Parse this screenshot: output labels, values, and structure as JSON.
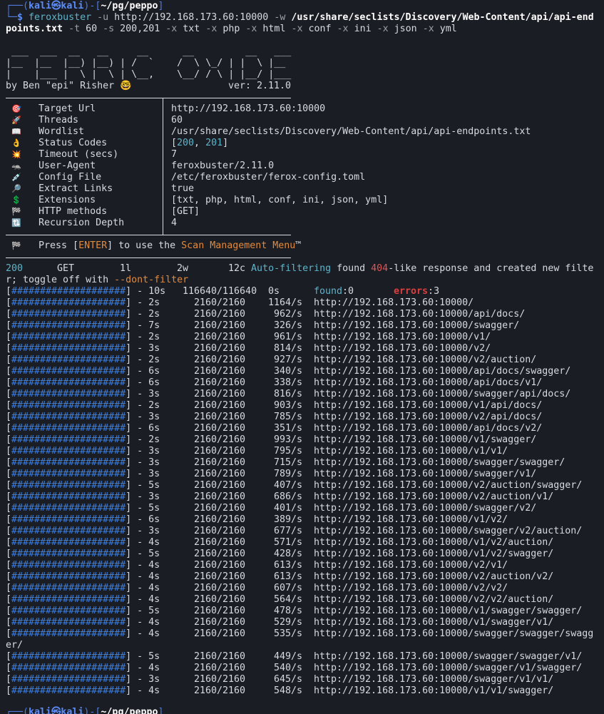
{
  "prompt": {
    "user": "kali",
    "at": "㉿",
    "host": "kali",
    "path": "~/pg/peppo",
    "cmd": "feroxbuster",
    "args": [
      {
        "flag": "-u",
        "val": "http://192.168.173.60:10000"
      },
      {
        "flag": "-w",
        "val": "/usr/share/seclists/Discovery/Web-Content/api/api-end"
      }
    ],
    "wrap_path": "points.txt",
    "wrap_args": [
      {
        "flag": "-t",
        "val": "60"
      },
      {
        "flag": "-s",
        "val": "200,201"
      },
      {
        "flag": "-x",
        "val": "txt"
      },
      {
        "flag": "-x",
        "val": "php"
      },
      {
        "flag": "-x",
        "val": "html"
      },
      {
        "flag": "-x",
        "val": "conf"
      },
      {
        "flag": "-x",
        "val": "ini"
      },
      {
        "flag": "-x",
        "val": "json"
      },
      {
        "flag": "-x",
        "val": "yml"
      }
    ]
  },
  "banner": {
    "art": [
      " ___  ___  __   __     __      __         __   ___",
      "|__  |__  |__) |__) | /  `    /  \\ \\_/ | |  \\ |__",
      "|    |___ |  \\ |  \\ | \\__,    \\__/ / \\ | |__/ |___"
    ],
    "author": "by Ben \"epi\" Risher 🤓",
    "version": "ver: 2.11.0"
  },
  "config": [
    {
      "icon": "🎯",
      "icon_name": "target-icon",
      "key": "Target Url",
      "value": "http://192.168.173.60:10000"
    },
    {
      "icon": "🚀",
      "icon_name": "rocket-icon",
      "key": "Threads",
      "value": "60"
    },
    {
      "icon": "📖",
      "icon_name": "book-icon",
      "key": "Wordlist",
      "value": "/usr/share/seclists/Discovery/Web-Content/api/api-endpoints.txt"
    },
    {
      "icon": "👌",
      "icon_name": "ok-hand-icon",
      "key": "Status Codes",
      "value": "",
      "codes": [
        "200",
        "201"
      ]
    },
    {
      "icon": "💥",
      "icon_name": "collision-icon",
      "key": "Timeout (secs)",
      "value": "7"
    },
    {
      "icon": "🦡",
      "icon_name": "badger-icon",
      "key": "User-Agent",
      "value": "feroxbuster/2.11.0"
    },
    {
      "icon": "💉",
      "icon_name": "syringe-icon",
      "key": "Config File",
      "value": "/etc/feroxbuster/ferox-config.toml"
    },
    {
      "icon": "🔎",
      "icon_name": "magnifier-icon",
      "key": "Extract Links",
      "value": "true"
    },
    {
      "icon": "💲",
      "icon_name": "dollar-icon",
      "key": "Extensions",
      "value": "[txt, php, html, conf, ini, json, yml]"
    },
    {
      "icon": "🏁",
      "icon_name": "flag-icon",
      "key": "HTTP methods",
      "value": "[GET]"
    },
    {
      "icon": "🔃",
      "icon_name": "recursion-icon",
      "key": "Recursion Depth",
      "value": "4"
    }
  ],
  "menu_hint": {
    "icon": "🏁",
    "pre": "Press [",
    "key": "ENTER",
    "mid": "] to use the ",
    "menu": "Scan Management Menu",
    "post": "™"
  },
  "autofilter": {
    "status": "200",
    "method": "GET",
    "lines": "1l",
    "words": "2w",
    "chars": "12c",
    "label": "Auto-filtering",
    "pre": " found ",
    "code": "404",
    "post": "-like response and created new filte",
    "wrap": "r; toggle off with ",
    "flag": "--dont-filter"
  },
  "overall": {
    "bar": "####################",
    "time": "10s",
    "count": "116640/116640",
    "rate": "0s",
    "found_label": "found",
    "found": "0",
    "errors_label": "errors",
    "errors": "3"
  },
  "progress": [
    {
      "time": "2s",
      "count": "2160/2160",
      "rate": "1164/s",
      "url": "http://192.168.173.60:10000/"
    },
    {
      "time": "2s",
      "count": "2160/2160",
      "rate": "962/s",
      "url": "http://192.168.173.60:10000/api/docs/"
    },
    {
      "time": "7s",
      "count": "2160/2160",
      "rate": "326/s",
      "url": "http://192.168.173.60:10000/swagger/"
    },
    {
      "time": "2s",
      "count": "2160/2160",
      "rate": "961/s",
      "url": "http://192.168.173.60:10000/v1/"
    },
    {
      "time": "3s",
      "count": "2160/2160",
      "rate": "814/s",
      "url": "http://192.168.173.60:10000/v2/"
    },
    {
      "time": "2s",
      "count": "2160/2160",
      "rate": "927/s",
      "url": "http://192.168.173.60:10000/v2/auction/"
    },
    {
      "time": "6s",
      "count": "2160/2160",
      "rate": "340/s",
      "url": "http://192.168.173.60:10000/api/docs/swagger/"
    },
    {
      "time": "6s",
      "count": "2160/2160",
      "rate": "338/s",
      "url": "http://192.168.173.60:10000/api/docs/v1/"
    },
    {
      "time": "3s",
      "count": "2160/2160",
      "rate": "816/s",
      "url": "http://192.168.173.60:10000/swagger/api/docs/"
    },
    {
      "time": "2s",
      "count": "2160/2160",
      "rate": "903/s",
      "url": "http://192.168.173.60:10000/v1/api/docs/"
    },
    {
      "time": "3s",
      "count": "2160/2160",
      "rate": "785/s",
      "url": "http://192.168.173.60:10000/v2/api/docs/"
    },
    {
      "time": "6s",
      "count": "2160/2160",
      "rate": "351/s",
      "url": "http://192.168.173.60:10000/api/docs/v2/"
    },
    {
      "time": "2s",
      "count": "2160/2160",
      "rate": "993/s",
      "url": "http://192.168.173.60:10000/v1/swagger/"
    },
    {
      "time": "3s",
      "count": "2160/2160",
      "rate": "795/s",
      "url": "http://192.168.173.60:10000/v1/v1/"
    },
    {
      "time": "3s",
      "count": "2160/2160",
      "rate": "715/s",
      "url": "http://192.168.173.60:10000/swagger/swagger/"
    },
    {
      "time": "3s",
      "count": "2160/2160",
      "rate": "789/s",
      "url": "http://192.168.173.60:10000/swagger/v1/"
    },
    {
      "time": "5s",
      "count": "2160/2160",
      "rate": "407/s",
      "url": "http://192.168.173.60:10000/v2/auction/swagger/"
    },
    {
      "time": "3s",
      "count": "2160/2160",
      "rate": "686/s",
      "url": "http://192.168.173.60:10000/v2/auction/v1/"
    },
    {
      "time": "5s",
      "count": "2160/2160",
      "rate": "401/s",
      "url": "http://192.168.173.60:10000/swagger/v2/"
    },
    {
      "time": "6s",
      "count": "2160/2160",
      "rate": "389/s",
      "url": "http://192.168.173.60:10000/v1/v2/"
    },
    {
      "time": "3s",
      "count": "2160/2160",
      "rate": "677/s",
      "url": "http://192.168.173.60:10000/swagger/v2/auction/"
    },
    {
      "time": "4s",
      "count": "2160/2160",
      "rate": "571/s",
      "url": "http://192.168.173.60:10000/v1/v2/auction/"
    },
    {
      "time": "5s",
      "count": "2160/2160",
      "rate": "428/s",
      "url": "http://192.168.173.60:10000/v1/v2/swagger/"
    },
    {
      "time": "4s",
      "count": "2160/2160",
      "rate": "613/s",
      "url": "http://192.168.173.60:10000/v2/v1/"
    },
    {
      "time": "4s",
      "count": "2160/2160",
      "rate": "613/s",
      "url": "http://192.168.173.60:10000/v2/auction/v2/"
    },
    {
      "time": "4s",
      "count": "2160/2160",
      "rate": "607/s",
      "url": "http://192.168.173.60:10000/v2/v2/"
    },
    {
      "time": "4s",
      "count": "2160/2160",
      "rate": "564/s",
      "url": "http://192.168.173.60:10000/v2/v2/auction/"
    },
    {
      "time": "5s",
      "count": "2160/2160",
      "rate": "478/s",
      "url": "http://192.168.173.60:10000/v1/swagger/swagger/"
    },
    {
      "time": "4s",
      "count": "2160/2160",
      "rate": "529/s",
      "url": "http://192.168.173.60:10000/v1/swagger/v1/"
    },
    {
      "time": "4s",
      "count": "2160/2160",
      "rate": "535/s",
      "url": "http://192.168.173.60:10000/swagger/swagger/swagg",
      "wrap": "er/"
    },
    {
      "time": "5s",
      "count": "2160/2160",
      "rate": "449/s",
      "url": "http://192.168.173.60:10000/swagger/swagger/v1/"
    },
    {
      "time": "4s",
      "count": "2160/2160",
      "rate": "540/s",
      "url": "http://192.168.173.60:10000/swagger/v1/swagger/"
    },
    {
      "time": "3s",
      "count": "2160/2160",
      "rate": "645/s",
      "url": "http://192.168.173.60:10000/swagger/v1/v1/"
    },
    {
      "time": "4s",
      "count": "2160/2160",
      "rate": "548/s",
      "url": "http://192.168.173.60:10000/v1/v1/swagger/"
    }
  ],
  "bar_fill": "####################",
  "trailing_prompt": {
    "path": "~/pg/peppo"
  },
  "colors": {
    "bg": "#1b1d24",
    "accent": "#4f7bdc",
    "orange": "#e08a3c",
    "error": "#e05555"
  }
}
